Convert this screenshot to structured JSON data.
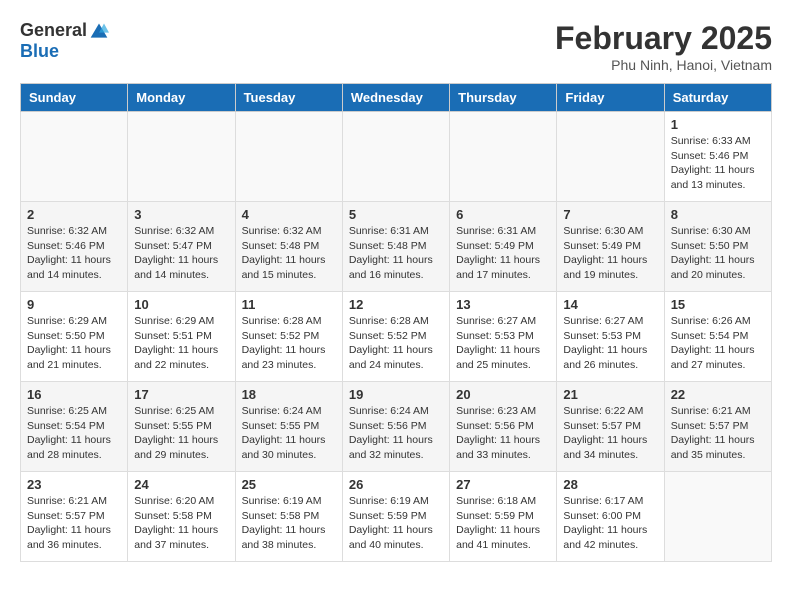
{
  "header": {
    "logo_general": "General",
    "logo_blue": "Blue",
    "month_title": "February 2025",
    "location": "Phu Ninh, Hanoi, Vietnam"
  },
  "weekdays": [
    "Sunday",
    "Monday",
    "Tuesday",
    "Wednesday",
    "Thursday",
    "Friday",
    "Saturday"
  ],
  "weeks": [
    {
      "alt": false,
      "days": [
        {
          "num": "",
          "info": ""
        },
        {
          "num": "",
          "info": ""
        },
        {
          "num": "",
          "info": ""
        },
        {
          "num": "",
          "info": ""
        },
        {
          "num": "",
          "info": ""
        },
        {
          "num": "",
          "info": ""
        },
        {
          "num": "1",
          "info": "Sunrise: 6:33 AM\nSunset: 5:46 PM\nDaylight: 11 hours\nand 13 minutes."
        }
      ]
    },
    {
      "alt": true,
      "days": [
        {
          "num": "2",
          "info": "Sunrise: 6:32 AM\nSunset: 5:46 PM\nDaylight: 11 hours\nand 14 minutes."
        },
        {
          "num": "3",
          "info": "Sunrise: 6:32 AM\nSunset: 5:47 PM\nDaylight: 11 hours\nand 14 minutes."
        },
        {
          "num": "4",
          "info": "Sunrise: 6:32 AM\nSunset: 5:48 PM\nDaylight: 11 hours\nand 15 minutes."
        },
        {
          "num": "5",
          "info": "Sunrise: 6:31 AM\nSunset: 5:48 PM\nDaylight: 11 hours\nand 16 minutes."
        },
        {
          "num": "6",
          "info": "Sunrise: 6:31 AM\nSunset: 5:49 PM\nDaylight: 11 hours\nand 17 minutes."
        },
        {
          "num": "7",
          "info": "Sunrise: 6:30 AM\nSunset: 5:49 PM\nDaylight: 11 hours\nand 19 minutes."
        },
        {
          "num": "8",
          "info": "Sunrise: 6:30 AM\nSunset: 5:50 PM\nDaylight: 11 hours\nand 20 minutes."
        }
      ]
    },
    {
      "alt": false,
      "days": [
        {
          "num": "9",
          "info": "Sunrise: 6:29 AM\nSunset: 5:50 PM\nDaylight: 11 hours\nand 21 minutes."
        },
        {
          "num": "10",
          "info": "Sunrise: 6:29 AM\nSunset: 5:51 PM\nDaylight: 11 hours\nand 22 minutes."
        },
        {
          "num": "11",
          "info": "Sunrise: 6:28 AM\nSunset: 5:52 PM\nDaylight: 11 hours\nand 23 minutes."
        },
        {
          "num": "12",
          "info": "Sunrise: 6:28 AM\nSunset: 5:52 PM\nDaylight: 11 hours\nand 24 minutes."
        },
        {
          "num": "13",
          "info": "Sunrise: 6:27 AM\nSunset: 5:53 PM\nDaylight: 11 hours\nand 25 minutes."
        },
        {
          "num": "14",
          "info": "Sunrise: 6:27 AM\nSunset: 5:53 PM\nDaylight: 11 hours\nand 26 minutes."
        },
        {
          "num": "15",
          "info": "Sunrise: 6:26 AM\nSunset: 5:54 PM\nDaylight: 11 hours\nand 27 minutes."
        }
      ]
    },
    {
      "alt": true,
      "days": [
        {
          "num": "16",
          "info": "Sunrise: 6:25 AM\nSunset: 5:54 PM\nDaylight: 11 hours\nand 28 minutes."
        },
        {
          "num": "17",
          "info": "Sunrise: 6:25 AM\nSunset: 5:55 PM\nDaylight: 11 hours\nand 29 minutes."
        },
        {
          "num": "18",
          "info": "Sunrise: 6:24 AM\nSunset: 5:55 PM\nDaylight: 11 hours\nand 30 minutes."
        },
        {
          "num": "19",
          "info": "Sunrise: 6:24 AM\nSunset: 5:56 PM\nDaylight: 11 hours\nand 32 minutes."
        },
        {
          "num": "20",
          "info": "Sunrise: 6:23 AM\nSunset: 5:56 PM\nDaylight: 11 hours\nand 33 minutes."
        },
        {
          "num": "21",
          "info": "Sunrise: 6:22 AM\nSunset: 5:57 PM\nDaylight: 11 hours\nand 34 minutes."
        },
        {
          "num": "22",
          "info": "Sunrise: 6:21 AM\nSunset: 5:57 PM\nDaylight: 11 hours\nand 35 minutes."
        }
      ]
    },
    {
      "alt": false,
      "days": [
        {
          "num": "23",
          "info": "Sunrise: 6:21 AM\nSunset: 5:57 PM\nDaylight: 11 hours\nand 36 minutes."
        },
        {
          "num": "24",
          "info": "Sunrise: 6:20 AM\nSunset: 5:58 PM\nDaylight: 11 hours\nand 37 minutes."
        },
        {
          "num": "25",
          "info": "Sunrise: 6:19 AM\nSunset: 5:58 PM\nDaylight: 11 hours\nand 38 minutes."
        },
        {
          "num": "26",
          "info": "Sunrise: 6:19 AM\nSunset: 5:59 PM\nDaylight: 11 hours\nand 40 minutes."
        },
        {
          "num": "27",
          "info": "Sunrise: 6:18 AM\nSunset: 5:59 PM\nDaylight: 11 hours\nand 41 minutes."
        },
        {
          "num": "28",
          "info": "Sunrise: 6:17 AM\nSunset: 6:00 PM\nDaylight: 11 hours\nand 42 minutes."
        },
        {
          "num": "",
          "info": ""
        }
      ]
    }
  ]
}
